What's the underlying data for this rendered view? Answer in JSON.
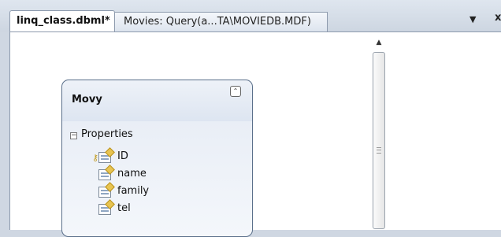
{
  "tabs": [
    {
      "label": "linq_class.dbml*",
      "active": true
    },
    {
      "label": "Movies: Query(a...TA\\MOVIEDB.MDF)",
      "active": false
    }
  ],
  "tab_menu_icon": "dropdown-arrow",
  "tab_close_icon": "close-x",
  "tab_menu_glyph": "▼",
  "tab_close_glyph": "x",
  "scrollbar": {
    "up_glyph": "▲",
    "grip_icon": "grip-lines"
  },
  "entity": {
    "name": "Movy",
    "collapse_glyph": "⌃",
    "section": {
      "toggle": "−",
      "label": "Properties"
    },
    "properties": [
      {
        "name": "ID",
        "primary_key": true
      },
      {
        "name": "name",
        "primary_key": false
      },
      {
        "name": "family",
        "primary_key": false
      },
      {
        "name": "tel",
        "primary_key": false
      }
    ]
  },
  "colors": {
    "entity_border": "#5a6f8a",
    "key": "#c29a1d",
    "background": "#cfd7e2"
  }
}
